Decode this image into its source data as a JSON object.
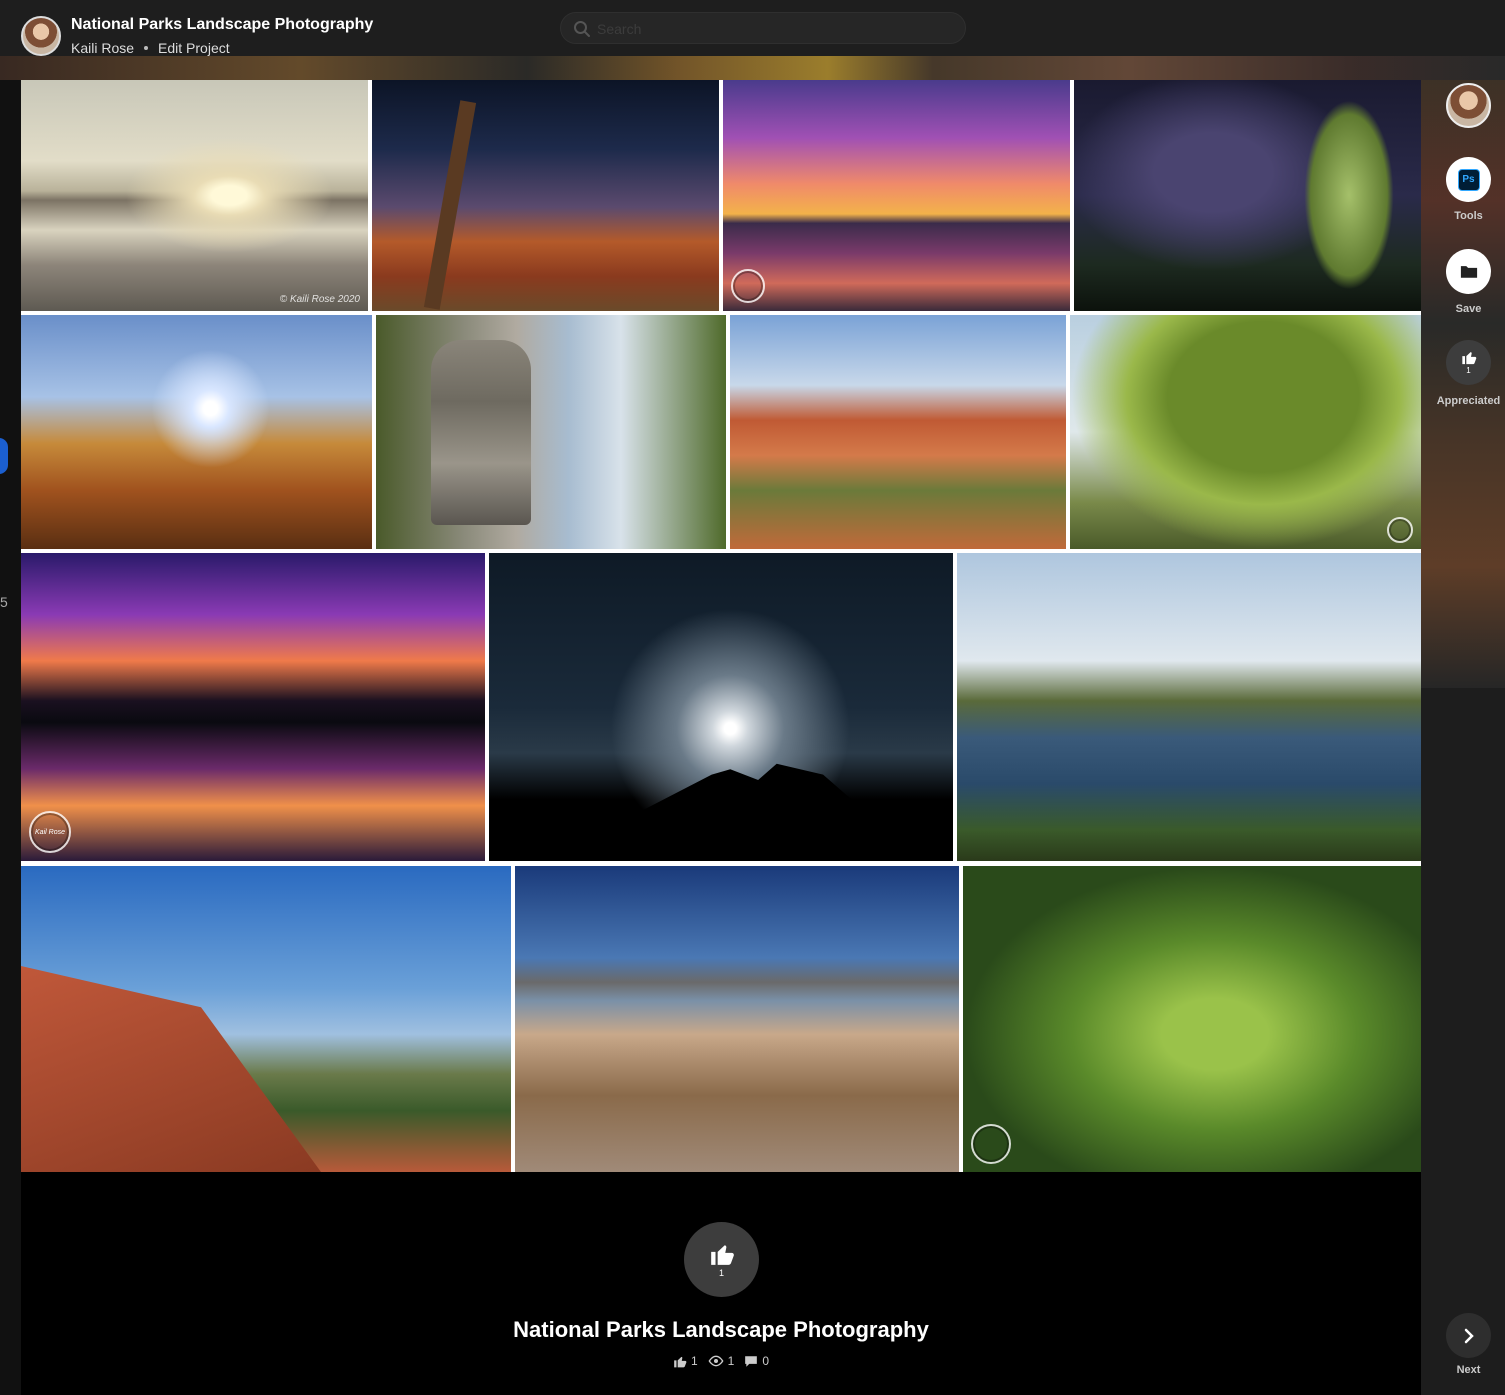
{
  "header": {
    "project_title": "National Parks Landscape Photography",
    "owner_name": "Kaili Rose",
    "edit_link": "Edit Project",
    "search_placeholder": "Search"
  },
  "watermarks": {
    "signature_1": "© Kaili Rose 2020",
    "logo": "Kail Rose"
  },
  "sidebar": {
    "tools_label": "Tools",
    "tools_badge": "Ps",
    "save_label": "Save",
    "appreciate_count": "1",
    "appreciated_label": "Appreciated",
    "next_label": "Next"
  },
  "bottom": {
    "appreciate_count": "1",
    "title": "National Parks Landscape Photography",
    "likes": "1",
    "views": "1",
    "comments": "0"
  },
  "left_edge": {
    "partial_text": "5"
  },
  "colors": {
    "page_bg": "#1d1d1d",
    "header_bg": "#1e1e1e",
    "footer_bg": "#000000",
    "button_bg": "#3d3d3d",
    "photoshop_blue": "#31a8ff"
  }
}
